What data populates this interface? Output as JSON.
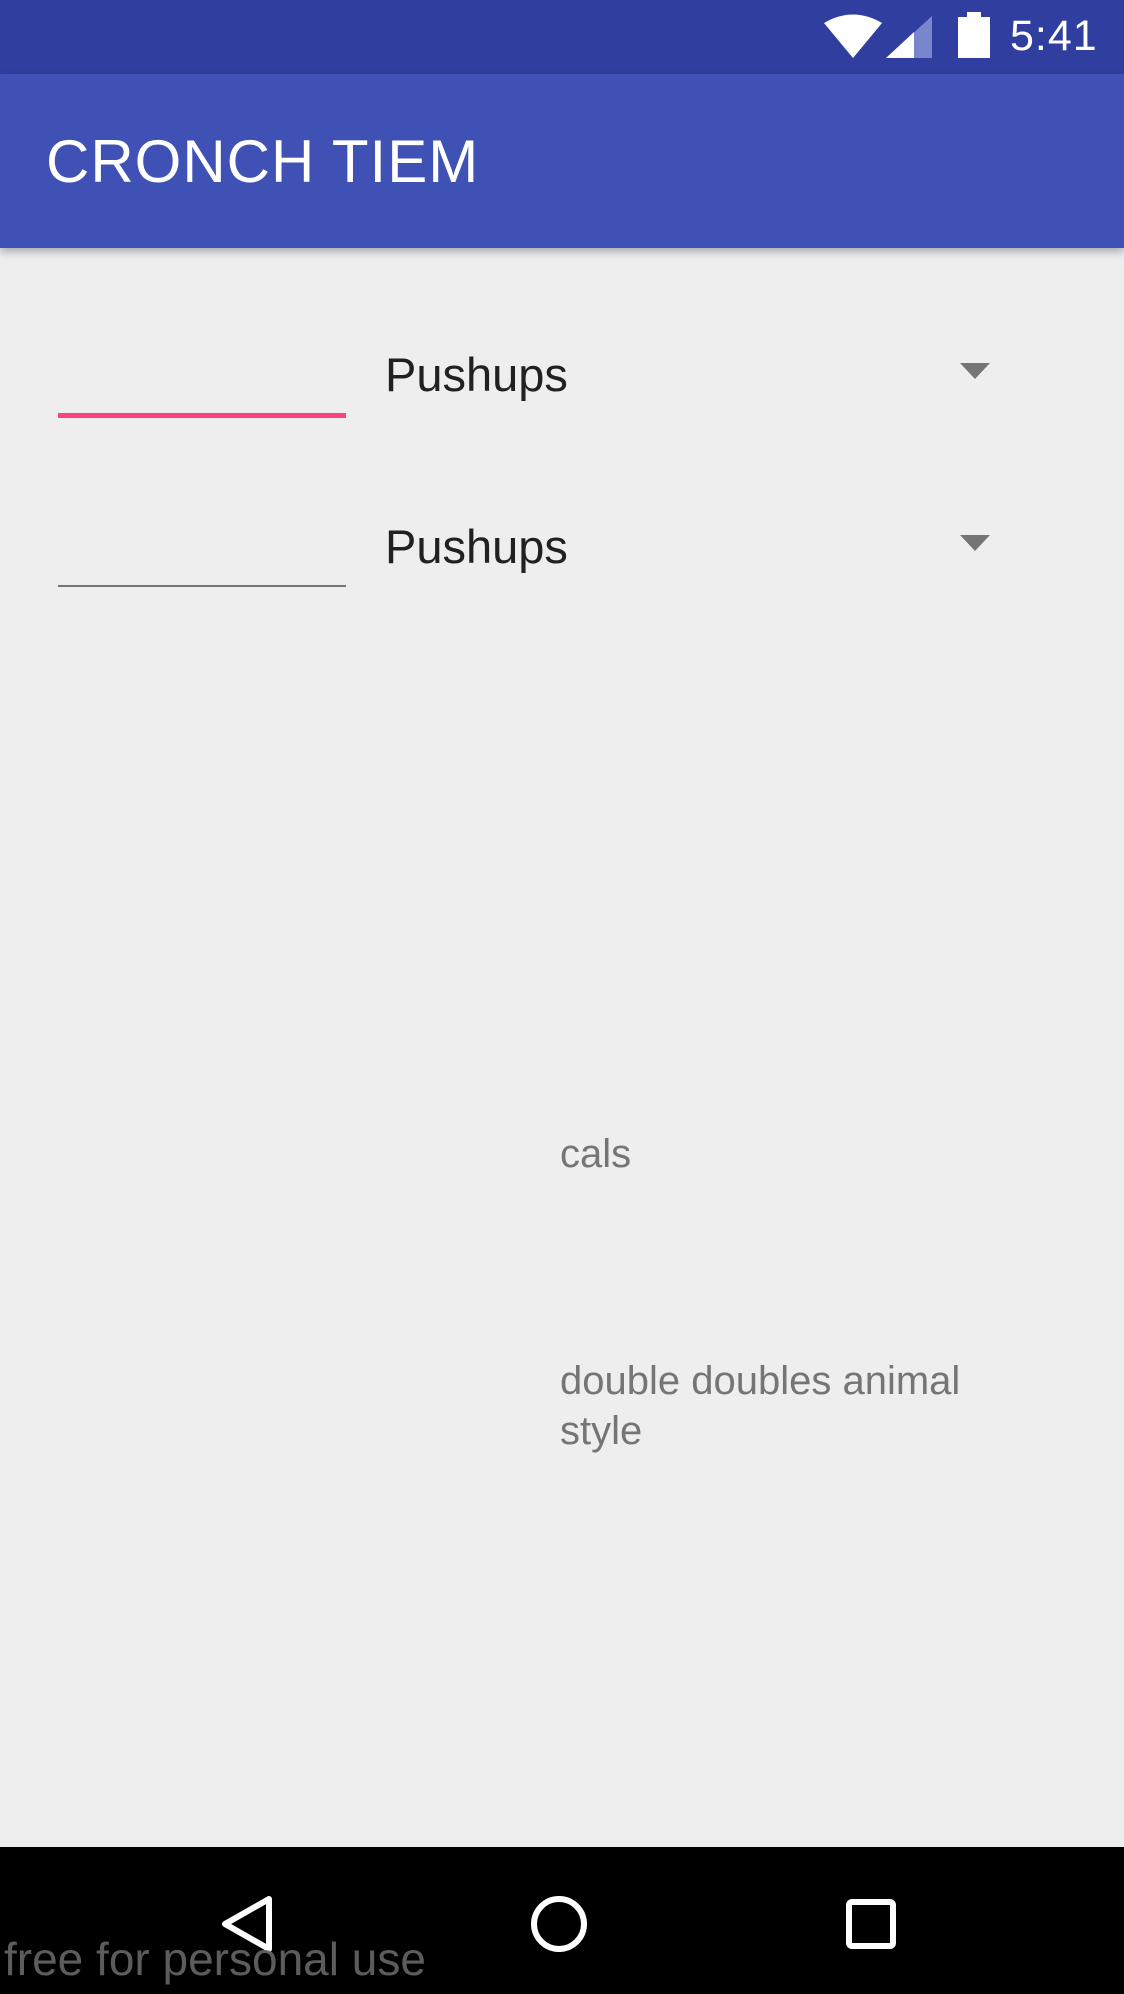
{
  "status_bar": {
    "time": "5:41",
    "icons": [
      "wifi-icon",
      "signal-icon",
      "battery-icon"
    ],
    "background": "#303f9f"
  },
  "app_bar": {
    "title": "CRONCH TIEM",
    "background": "#3f51b5"
  },
  "rows": [
    {
      "input_value": "",
      "input_focused": true,
      "spinner_selected": "Pushups",
      "spinner_icon": "dropdown-arrow-icon"
    },
    {
      "input_value": "",
      "input_focused": false,
      "spinner_selected": "Pushups",
      "spinner_icon": "dropdown-arrow-icon"
    }
  ],
  "results": {
    "calories_label": "cals",
    "food_label": "double doubles animal style"
  },
  "nav_bar": {
    "icons": [
      "back-icon",
      "home-icon",
      "recents-icon"
    ]
  },
  "watermark": "free for personal use",
  "colors": {
    "accent": "#ff4081",
    "background": "#eeeeee"
  }
}
